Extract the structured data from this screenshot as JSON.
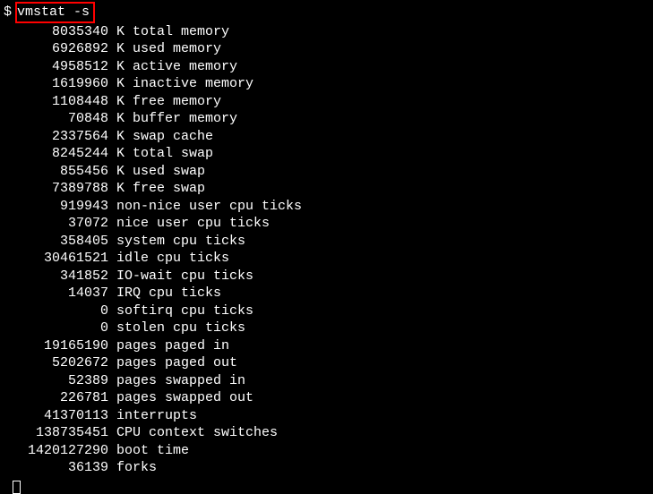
{
  "prompt": "$",
  "command": "vmstat -s",
  "rows": [
    {
      "value": "8035340",
      "label": "K total memory"
    },
    {
      "value": "6926892",
      "label": "K used memory"
    },
    {
      "value": "4958512",
      "label": "K active memory"
    },
    {
      "value": "1619960",
      "label": "K inactive memory"
    },
    {
      "value": "1108448",
      "label": "K free memory"
    },
    {
      "value": "70848",
      "label": "K buffer memory"
    },
    {
      "value": "2337564",
      "label": "K swap cache"
    },
    {
      "value": "8245244",
      "label": "K total swap"
    },
    {
      "value": "855456",
      "label": "K used swap"
    },
    {
      "value": "7389788",
      "label": "K free swap"
    },
    {
      "value": "919943",
      "label": "non-nice user cpu ticks"
    },
    {
      "value": "37072",
      "label": "nice user cpu ticks"
    },
    {
      "value": "358405",
      "label": "system cpu ticks"
    },
    {
      "value": "30461521",
      "label": "idle cpu ticks"
    },
    {
      "value": "341852",
      "label": "IO-wait cpu ticks"
    },
    {
      "value": "14037",
      "label": "IRQ cpu ticks"
    },
    {
      "value": "0",
      "label": "softirq cpu ticks"
    },
    {
      "value": "0",
      "label": "stolen cpu ticks"
    },
    {
      "value": "19165190",
      "label": "pages paged in"
    },
    {
      "value": "5202672",
      "label": "pages paged out"
    },
    {
      "value": "52389",
      "label": "pages swapped in"
    },
    {
      "value": "226781",
      "label": "pages swapped out"
    },
    {
      "value": "41370113",
      "label": "interrupts"
    },
    {
      "value": "138735451",
      "label": "CPU context switches"
    },
    {
      "value": "1420127290",
      "label": "boot time"
    },
    {
      "value": "36139",
      "label": "forks"
    }
  ]
}
